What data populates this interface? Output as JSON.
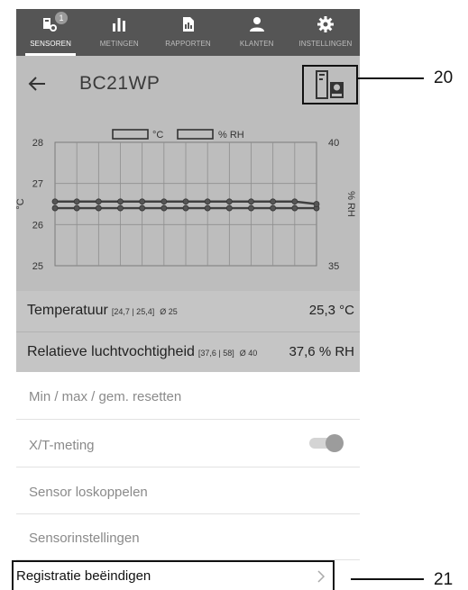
{
  "nav": {
    "items": [
      {
        "label": "SENSOREN",
        "icon": "sensor-icon",
        "active": true,
        "badge": "1"
      },
      {
        "label": "METINGEN",
        "icon": "bar-chart-icon",
        "active": false
      },
      {
        "label": "RAPPORTEN",
        "icon": "report-icon",
        "active": false
      },
      {
        "label": "KLANTEN",
        "icon": "customers-icon",
        "active": false
      },
      {
        "label": "INSTELLINGEN",
        "icon": "gear-icon",
        "active": false
      }
    ]
  },
  "header": {
    "title": "BC21WP",
    "back_icon": "back-arrow-icon",
    "logger_icon": "data-logger-rec-icon"
  },
  "chart_data": {
    "type": "line",
    "legend": [
      "°C",
      "% RH"
    ],
    "ylabel": "°C",
    "ylabel_right": "% RH",
    "y_ticks_left": [
      "28",
      "27",
      "26",
      "25"
    ],
    "y_ticks_right": [
      "40",
      "35"
    ],
    "ylim": [
      25,
      28
    ],
    "ylim_right": [
      35,
      40
    ],
    "grid": true,
    "series": [
      {
        "name": "°C",
        "axis": "left",
        "values": [
          26.4,
          26.4,
          26.4,
          26.4,
          26.4,
          26.4,
          26.4,
          26.4,
          26.4,
          26.4,
          26.4,
          26.4,
          26.4
        ]
      },
      {
        "name": "% RH",
        "axis": "right",
        "values": [
          37.6,
          37.6,
          37.6,
          37.6,
          37.6,
          37.6,
          37.6,
          37.6,
          37.6,
          37.6,
          37.6,
          37.6,
          37.5
        ]
      }
    ]
  },
  "readings": {
    "temp": {
      "name": "Temperatuur",
      "range": "[24,7 | 25,4]",
      "avg": "Ø 25",
      "value": "25,3 °C"
    },
    "rh": {
      "name": "Relatieve luchtvochtigheid",
      "range": "[37,6 | 58]",
      "avg": "Ø 40",
      "value": "37,6 % RH"
    }
  },
  "menu": {
    "reset": "Min / max / gem. resetten",
    "xt": "X/T-meting",
    "xt_enabled": true,
    "disconnect": "Sensor loskoppelen",
    "settings": "Sensorinstellingen",
    "end_registration": "Registratie beëindigen"
  },
  "callouts": {
    "logger": "20",
    "end": "21"
  }
}
